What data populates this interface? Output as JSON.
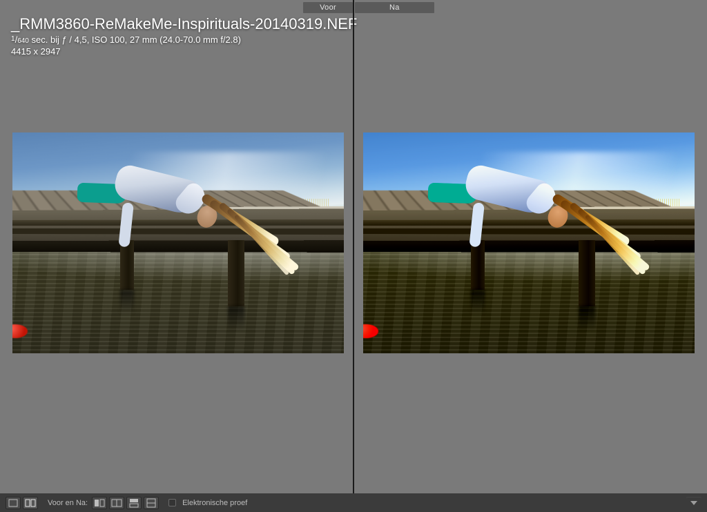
{
  "compare": {
    "before_label": "Voor",
    "after_label": "Na"
  },
  "info": {
    "filename": "_RMM3860-ReMakeMe-Inspirituals-20140319.NEF",
    "shutter_num": "1",
    "shutter_den": "640",
    "meta_rest": " sec. bij ƒ / 4,5, ISO 100, 27 mm (24.0-70.0 mm f/2.8)",
    "dimensions": "4415 x 2947"
  },
  "toolbar": {
    "loupe_icon": "loupe",
    "compare_label": "Voor en Na:",
    "softproof_label": "Elektronische proef"
  }
}
